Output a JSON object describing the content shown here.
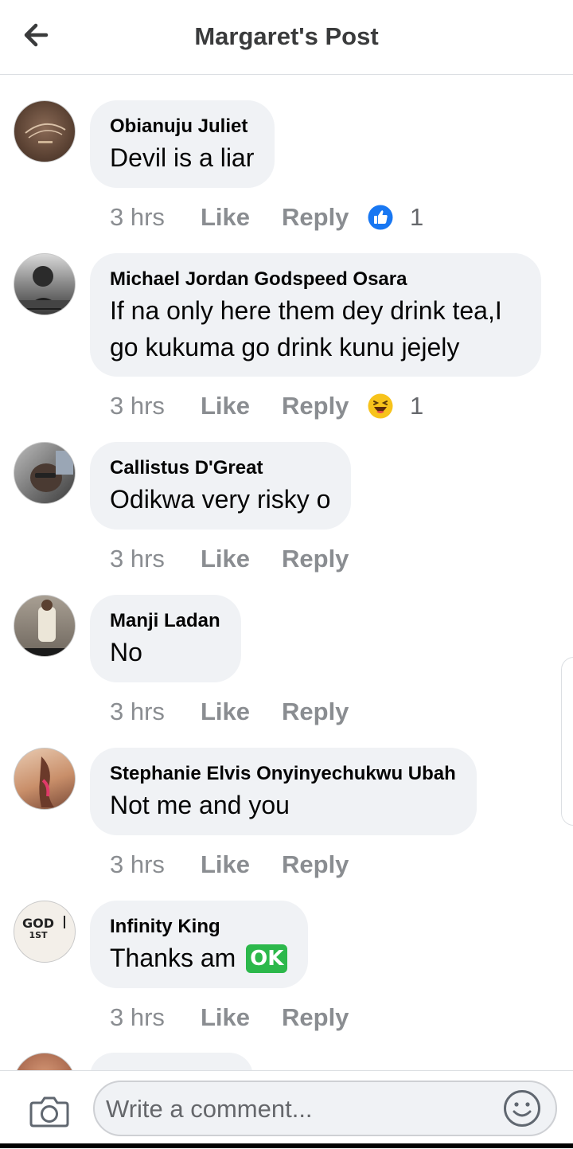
{
  "header": {
    "title": "Margaret's Post"
  },
  "comments": [
    {
      "author": "Obianuju Juliet",
      "text": "Devil is a liar",
      "time": "3 hrs",
      "like": "Like",
      "reply": "Reply",
      "reaction_icon": "like-icon",
      "reaction_count": "1"
    },
    {
      "author": "Michael Jordan Godspeed Osara",
      "text_line1": "If na only here them dey drink tea,I",
      "text_line2": "go kukuma go drink kunu jejely",
      "time": "3 hrs",
      "like": "Like",
      "reply": "Reply",
      "reaction_icon": "haha-icon",
      "reaction_count": "1"
    },
    {
      "author": "Callistus D'Great",
      "text": "Odikwa very risky o",
      "time": "3 hrs",
      "like": "Like",
      "reply": "Reply"
    },
    {
      "author": "Manji Ladan",
      "text": "No",
      "time": "3 hrs",
      "like": "Like",
      "reply": "Reply"
    },
    {
      "author": "Stephanie Elvis Onyinyechukwu Ubah",
      "text": "Not me and you",
      "time": "3 hrs",
      "like": "Like",
      "reply": "Reply"
    },
    {
      "author": "Infinity King",
      "text": "Thanks am",
      "emoji": "OK",
      "time": "3 hrs",
      "like": "Like",
      "reply": "Reply",
      "avatar_text_1": "GOD",
      "avatar_text_2": "1ST"
    }
  ],
  "composer": {
    "placeholder": "Write a comment..."
  },
  "colors": {
    "bubble": "#f0f2f5",
    "meta": "#8a8d91",
    "like_blue": "#1877f2",
    "ok_green": "#2cb84b"
  }
}
